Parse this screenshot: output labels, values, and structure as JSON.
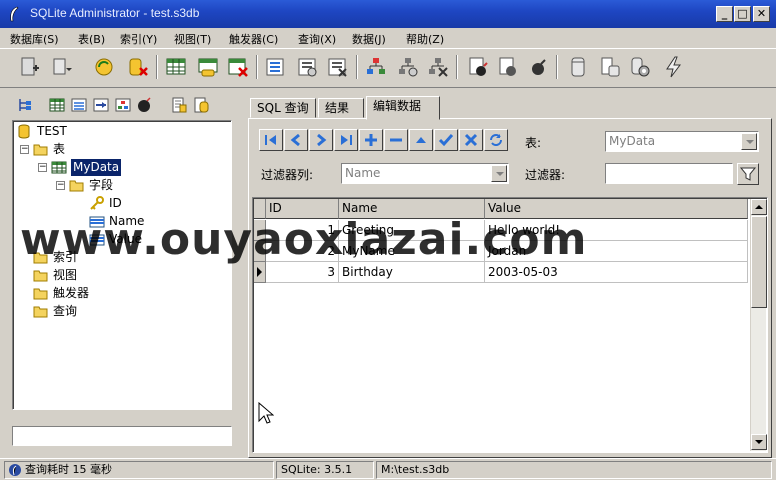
{
  "window": {
    "title": "SQLite Administrator - test.s3db"
  },
  "menu": [
    "数据库(S)",
    "表(B)",
    "索引(Y)",
    "视图(T)",
    "触发器(C)",
    "查询(X)",
    "数据(J)",
    "帮助(Z)"
  ],
  "tree": {
    "root": "TEST",
    "tables": "表",
    "table": "MyData",
    "fields": "字段",
    "field_items": [
      "ID",
      "Name",
      "Value"
    ],
    "indexes": "索引",
    "views": "视图",
    "triggers": "触发器",
    "queries": "查询"
  },
  "tabs": [
    "SQL 查询",
    "结果",
    "编辑数据"
  ],
  "editor": {
    "table_label": "表:",
    "table_value": "MyData",
    "filter_col_label": "过滤器列:",
    "filter_col_value": "Name",
    "filter_label": "过滤器:",
    "filter_value": ""
  },
  "grid": {
    "columns": [
      "ID",
      "Name",
      "Value"
    ],
    "rows": [
      [
        "1",
        "Greeting",
        "Hello world!"
      ],
      [
        "2",
        "MyName",
        "Jordan"
      ],
      [
        "3",
        "Birthday",
        "2003-05-03"
      ]
    ]
  },
  "status": {
    "message": "查询耗时 15 毫秒",
    "version": "SQLite: 3.5.1",
    "path": "M:\\test.s3db"
  },
  "watermark": "www.ouyaoxiazai.com",
  "colors": {
    "titlebar": "#1e46c2",
    "selection": "#0a246a",
    "chrome": "#d4d0c8",
    "nav_blue": "#2a6fd6"
  }
}
